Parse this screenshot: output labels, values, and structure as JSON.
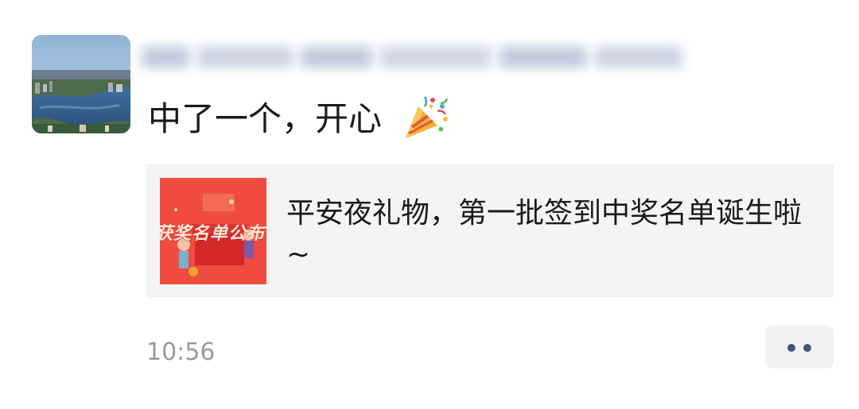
{
  "post": {
    "text": "中了一个，开心",
    "emoji": "party-popper-icon",
    "link_card": {
      "title": "平安夜礼物，第一批签到中奖名单诞生啦~",
      "thumbnail_text": "获奖名单公布",
      "thumbnail_color": "#ef4c3f"
    },
    "timestamp": "10:56"
  },
  "colors": {
    "text": "#1a1a1a",
    "timestamp": "#9a9a9a",
    "card_bg": "#f4f4f4",
    "more_dots": "#4a5478"
  }
}
